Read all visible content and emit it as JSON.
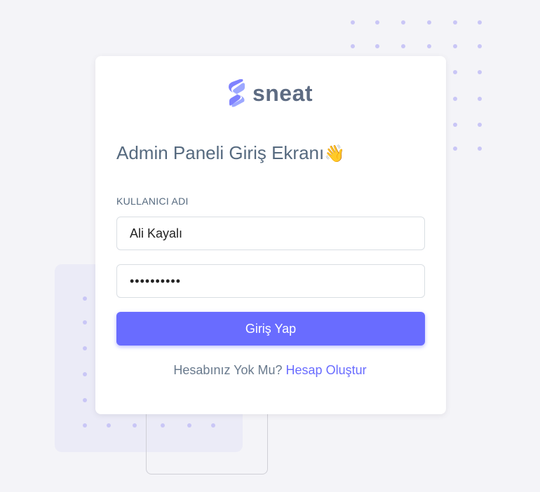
{
  "brand": {
    "name": "sneat",
    "logo_icon": "sneat-logo-icon"
  },
  "login": {
    "title": "Admin Paneli Giriş Ekranı",
    "title_emoji": "👋",
    "username_label": "KULLANICI ADI",
    "username_value": "Ali Kayalı",
    "password_value": "••••••••••",
    "submit_label": "Giriş Yap",
    "no_account_text": "Hesabınız Yok Mu?",
    "create_account_link": "Hesap Oluştur"
  },
  "colors": {
    "primary": "#696cff",
    "text": "#566a7f",
    "background": "#f4f4f8",
    "dots": "#c9c6f6"
  }
}
